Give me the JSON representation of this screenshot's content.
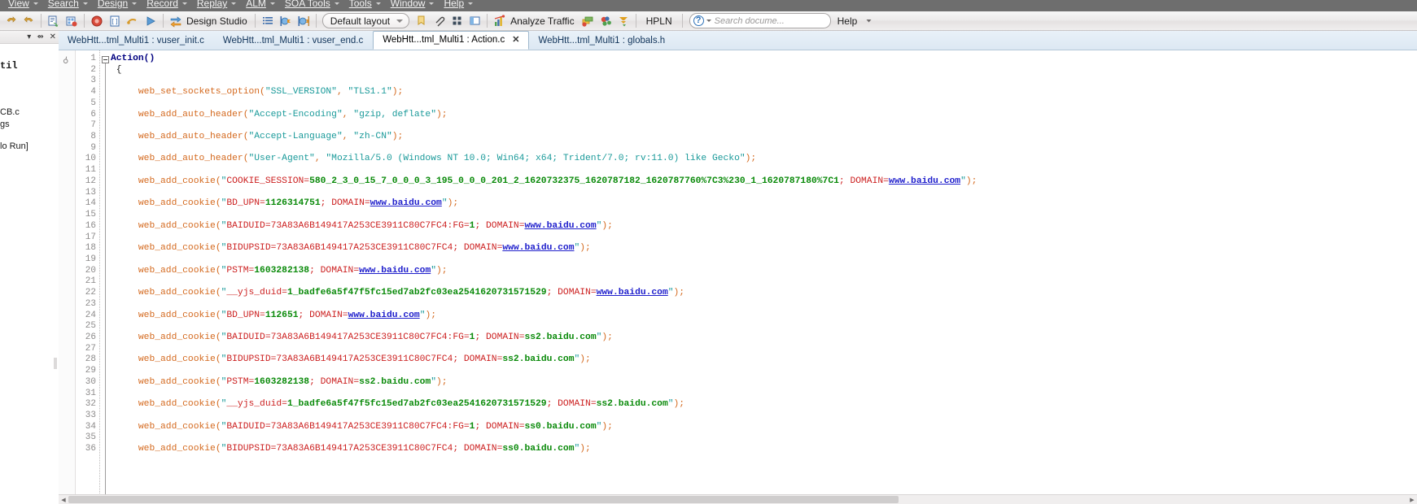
{
  "menubar": {
    "items": [
      {
        "label": "View",
        "has_caret": true
      },
      {
        "label": "Search",
        "has_caret": true
      },
      {
        "label": "Design",
        "has_caret": true
      },
      {
        "label": "Record",
        "has_caret": true
      },
      {
        "label": "Replay",
        "has_caret": true
      },
      {
        "label": "ALM",
        "has_caret": true
      },
      {
        "label": "SOA Tools",
        "has_caret": true
      },
      {
        "label": "Tools",
        "has_caret": true
      },
      {
        "label": "Window",
        "has_caret": true
      },
      {
        "label": "Help",
        "has_caret": true
      }
    ]
  },
  "toolbar": {
    "design_studio_label": "Design Studio",
    "layout_label": "Default layout",
    "analyze_traffic_label": "Analyze Traffic",
    "hpln_label": "HPLN",
    "search_placeholder": "Search docume...",
    "help_label": "Help",
    "icons": [
      "undo-icon",
      "redo-icon",
      "recompile-icon",
      "snapshot-icon",
      "record-icon",
      "step-icon",
      "pause-icon",
      "run-icon",
      "design-studio-icon",
      "task-list-icon",
      "runtime-settings-icon",
      "parameter-list-icon",
      "analyze-traffic-icon",
      "correlation-icon",
      "network-icon",
      "export-icon",
      "bookmark-icon",
      "attachment-icon",
      "grid-icon",
      "window-icon"
    ]
  },
  "left_panel": {
    "header_icons": [
      "chevron-down-icon",
      "pin-icon",
      "close-icon"
    ],
    "rows": [
      {
        "text": "til",
        "bold": true
      },
      {
        "text": "CB.c",
        "bold": false
      },
      {
        "text": "gs",
        "bold": false
      },
      {
        "text": "lo Run]",
        "bold": false
      }
    ]
  },
  "tabs": [
    {
      "label": "WebHtt...tml_Multi1 : vuser_init.c",
      "active": false,
      "closable": false
    },
    {
      "label": "WebHtt...tml_Multi1 : vuser_end.c",
      "active": false,
      "closable": false
    },
    {
      "label": "WebHtt...tml_Multi1 : Action.c",
      "active": true,
      "closable": true,
      "close_glyph": "✕"
    },
    {
      "label": "WebHtt...tml_Multi1 : globals.h",
      "active": false,
      "closable": false
    }
  ],
  "editor": {
    "total_lines": 36,
    "line_numbers": [
      1,
      2,
      3,
      4,
      5,
      6,
      7,
      8,
      9,
      10,
      11,
      12,
      13,
      14,
      15,
      16,
      17,
      18,
      19,
      20,
      21,
      22,
      23,
      24,
      25,
      26,
      27,
      28,
      29,
      30,
      31,
      32,
      33,
      34,
      35,
      36
    ],
    "lines": [
      {
        "n": 1,
        "segments": [
          {
            "t": "Action()",
            "c": "kw"
          }
        ]
      },
      {
        "n": 2,
        "segments": [
          {
            "t": " {",
            "c": "brc"
          }
        ]
      },
      {
        "n": 3,
        "segments": []
      },
      {
        "n": 4,
        "segments": [
          {
            "t": "     web_set_sockets_option",
            "c": "fn"
          },
          {
            "t": "(",
            "c": "pun"
          },
          {
            "t": "\"SSL_VERSION\"",
            "c": "str"
          },
          {
            "t": ", ",
            "c": "pun"
          },
          {
            "t": "\"TLS1.1\"",
            "c": "str"
          },
          {
            "t": ");",
            "c": "pun"
          }
        ]
      },
      {
        "n": 5,
        "segments": []
      },
      {
        "n": 6,
        "segments": [
          {
            "t": "     web_add_auto_header",
            "c": "fn"
          },
          {
            "t": "(",
            "c": "pun"
          },
          {
            "t": "\"Accept-Encoding\"",
            "c": "str"
          },
          {
            "t": ", ",
            "c": "pun"
          },
          {
            "t": "\"gzip, deflate\"",
            "c": "str"
          },
          {
            "t": ");",
            "c": "pun"
          }
        ]
      },
      {
        "n": 7,
        "segments": []
      },
      {
        "n": 8,
        "segments": [
          {
            "t": "     web_add_auto_header",
            "c": "fn"
          },
          {
            "t": "(",
            "c": "pun"
          },
          {
            "t": "\"Accept-Language\"",
            "c": "str"
          },
          {
            "t": ", ",
            "c": "pun"
          },
          {
            "t": "\"zh-CN\"",
            "c": "str"
          },
          {
            "t": ");",
            "c": "pun"
          }
        ]
      },
      {
        "n": 9,
        "segments": []
      },
      {
        "n": 10,
        "segments": [
          {
            "t": "     web_add_auto_header",
            "c": "fn"
          },
          {
            "t": "(",
            "c": "pun"
          },
          {
            "t": "\"User-Agent\"",
            "c": "str"
          },
          {
            "t": ", ",
            "c": "pun"
          },
          {
            "t": "\"Mozilla/5.0 (Windows NT 10.0; Win64; x64; Trident/7.0; rv:11.0) like Gecko\"",
            "c": "str"
          },
          {
            "t": ");",
            "c": "pun"
          }
        ]
      },
      {
        "n": 11,
        "segments": []
      },
      {
        "n": 12,
        "segments": [
          {
            "t": "     web_add_cookie",
            "c": "fn"
          },
          {
            "t": "(",
            "c": "pun"
          },
          {
            "t": "\"",
            "c": "str"
          },
          {
            "t": "COOKIE_SESSION=",
            "c": "ckey"
          },
          {
            "t": "580_2_3_0_15_7_0_0_0_3_195_0_0_0_201_2_1620732375_1620787182_1620787760%7C3%230_1_1620787180%7C1",
            "c": "cval"
          },
          {
            "t": "; ",
            "c": "ckey"
          },
          {
            "t": "DOMAIN=",
            "c": "dom"
          },
          {
            "t": "www.baidu.com",
            "c": "lnk"
          },
          {
            "t": "\"",
            "c": "str"
          },
          {
            "t": ");",
            "c": "pun"
          }
        ]
      },
      {
        "n": 13,
        "segments": []
      },
      {
        "n": 14,
        "segments": [
          {
            "t": "     web_add_cookie",
            "c": "fn"
          },
          {
            "t": "(",
            "c": "pun"
          },
          {
            "t": "\"",
            "c": "str"
          },
          {
            "t": "BD_UPN=",
            "c": "ckey"
          },
          {
            "t": "1126314751",
            "c": "cval"
          },
          {
            "t": "; ",
            "c": "ckey"
          },
          {
            "t": "DOMAIN=",
            "c": "dom"
          },
          {
            "t": "www.baidu.com",
            "c": "lnk"
          },
          {
            "t": "\"",
            "c": "str"
          },
          {
            "t": ");",
            "c": "pun"
          }
        ]
      },
      {
        "n": 15,
        "segments": []
      },
      {
        "n": 16,
        "segments": [
          {
            "t": "     web_add_cookie",
            "c": "fn"
          },
          {
            "t": "(",
            "c": "pun"
          },
          {
            "t": "\"",
            "c": "str"
          },
          {
            "t": "BAIDUID=73A83A6B149417A253CE3911C80C7FC4:FG=",
            "c": "ckey"
          },
          {
            "t": "1",
            "c": "cval"
          },
          {
            "t": "; ",
            "c": "ckey"
          },
          {
            "t": "DOMAIN=",
            "c": "dom"
          },
          {
            "t": "www.baidu.com",
            "c": "lnk"
          },
          {
            "t": "\"",
            "c": "str"
          },
          {
            "t": ");",
            "c": "pun"
          }
        ]
      },
      {
        "n": 17,
        "segments": []
      },
      {
        "n": 18,
        "segments": [
          {
            "t": "     web_add_cookie",
            "c": "fn"
          },
          {
            "t": "(",
            "c": "pun"
          },
          {
            "t": "\"",
            "c": "str"
          },
          {
            "t": "BIDUPSID=73A83A6B149417A253CE3911C80C7FC4",
            "c": "ckey"
          },
          {
            "t": "; ",
            "c": "ckey"
          },
          {
            "t": "DOMAIN=",
            "c": "dom"
          },
          {
            "t": "www.baidu.com",
            "c": "lnk"
          },
          {
            "t": "\"",
            "c": "str"
          },
          {
            "t": ");",
            "c": "pun"
          }
        ]
      },
      {
        "n": 19,
        "segments": []
      },
      {
        "n": 20,
        "segments": [
          {
            "t": "     web_add_cookie",
            "c": "fn"
          },
          {
            "t": "(",
            "c": "pun"
          },
          {
            "t": "\"",
            "c": "str"
          },
          {
            "t": "PSTM=",
            "c": "ckey"
          },
          {
            "t": "1603282138",
            "c": "cval"
          },
          {
            "t": "; ",
            "c": "ckey"
          },
          {
            "t": "DOMAIN=",
            "c": "dom"
          },
          {
            "t": "www.baidu.com",
            "c": "lnk"
          },
          {
            "t": "\"",
            "c": "str"
          },
          {
            "t": ");",
            "c": "pun"
          }
        ]
      },
      {
        "n": 21,
        "segments": []
      },
      {
        "n": 22,
        "segments": [
          {
            "t": "     web_add_cookie",
            "c": "fn"
          },
          {
            "t": "(",
            "c": "pun"
          },
          {
            "t": "\"",
            "c": "str"
          },
          {
            "t": "__yjs_duid=",
            "c": "ckey"
          },
          {
            "t": "1_badfe6a5f47f5fc15ed7ab2fc03ea2541620731571529",
            "c": "cval"
          },
          {
            "t": "; ",
            "c": "ckey"
          },
          {
            "t": "DOMAIN=",
            "c": "dom"
          },
          {
            "t": "www.baidu.com",
            "c": "lnk"
          },
          {
            "t": "\"",
            "c": "str"
          },
          {
            "t": ");",
            "c": "pun"
          }
        ]
      },
      {
        "n": 23,
        "segments": []
      },
      {
        "n": 24,
        "segments": [
          {
            "t": "     web_add_cookie",
            "c": "fn"
          },
          {
            "t": "(",
            "c": "pun"
          },
          {
            "t": "\"",
            "c": "str"
          },
          {
            "t": "BD_UPN=",
            "c": "ckey"
          },
          {
            "t": "112651",
            "c": "cval"
          },
          {
            "t": "; ",
            "c": "ckey"
          },
          {
            "t": "DOMAIN=",
            "c": "dom"
          },
          {
            "t": "www.baidu.com",
            "c": "lnk"
          },
          {
            "t": "\"",
            "c": "str"
          },
          {
            "t": ");",
            "c": "pun"
          }
        ]
      },
      {
        "n": 25,
        "segments": []
      },
      {
        "n": 26,
        "segments": [
          {
            "t": "     web_add_cookie",
            "c": "fn"
          },
          {
            "t": "(",
            "c": "pun"
          },
          {
            "t": "\"",
            "c": "str"
          },
          {
            "t": "BAIDUID=73A83A6B149417A253CE3911C80C7FC4:FG=",
            "c": "ckey"
          },
          {
            "t": "1",
            "c": "cval"
          },
          {
            "t": "; ",
            "c": "ckey"
          },
          {
            "t": "DOMAIN=",
            "c": "dom"
          },
          {
            "t": "ss2.baidu.com",
            "c": "cval"
          },
          {
            "t": "\"",
            "c": "str"
          },
          {
            "t": ");",
            "c": "pun"
          }
        ]
      },
      {
        "n": 27,
        "segments": []
      },
      {
        "n": 28,
        "segments": [
          {
            "t": "     web_add_cookie",
            "c": "fn"
          },
          {
            "t": "(",
            "c": "pun"
          },
          {
            "t": "\"",
            "c": "str"
          },
          {
            "t": "BIDUPSID=73A83A6B149417A253CE3911C80C7FC4",
            "c": "ckey"
          },
          {
            "t": "; ",
            "c": "ckey"
          },
          {
            "t": "DOMAIN=",
            "c": "dom"
          },
          {
            "t": "ss2.baidu.com",
            "c": "cval"
          },
          {
            "t": "\"",
            "c": "str"
          },
          {
            "t": ");",
            "c": "pun"
          }
        ]
      },
      {
        "n": 29,
        "segments": []
      },
      {
        "n": 30,
        "segments": [
          {
            "t": "     web_add_cookie",
            "c": "fn"
          },
          {
            "t": "(",
            "c": "pun"
          },
          {
            "t": "\"",
            "c": "str"
          },
          {
            "t": "PSTM=",
            "c": "ckey"
          },
          {
            "t": "1603282138",
            "c": "cval"
          },
          {
            "t": "; ",
            "c": "ckey"
          },
          {
            "t": "DOMAIN=",
            "c": "dom"
          },
          {
            "t": "ss2.baidu.com",
            "c": "cval"
          },
          {
            "t": "\"",
            "c": "str"
          },
          {
            "t": ");",
            "c": "pun"
          }
        ]
      },
      {
        "n": 31,
        "segments": []
      },
      {
        "n": 32,
        "segments": [
          {
            "t": "     web_add_cookie",
            "c": "fn"
          },
          {
            "t": "(",
            "c": "pun"
          },
          {
            "t": "\"",
            "c": "str"
          },
          {
            "t": "__yjs_duid=",
            "c": "ckey"
          },
          {
            "t": "1_badfe6a5f47f5fc15ed7ab2fc03ea2541620731571529",
            "c": "cval"
          },
          {
            "t": "; ",
            "c": "ckey"
          },
          {
            "t": "DOMAIN=",
            "c": "dom"
          },
          {
            "t": "ss2.baidu.com",
            "c": "cval"
          },
          {
            "t": "\"",
            "c": "str"
          },
          {
            "t": ");",
            "c": "pun"
          }
        ]
      },
      {
        "n": 33,
        "segments": []
      },
      {
        "n": 34,
        "segments": [
          {
            "t": "     web_add_cookie",
            "c": "fn"
          },
          {
            "t": "(",
            "c": "pun"
          },
          {
            "t": "\"",
            "c": "str"
          },
          {
            "t": "BAIDUID=73A83A6B149417A253CE3911C80C7FC4:FG=",
            "c": "ckey"
          },
          {
            "t": "1",
            "c": "cval"
          },
          {
            "t": "; ",
            "c": "ckey"
          },
          {
            "t": "DOMAIN=",
            "c": "dom"
          },
          {
            "t": "ss0.baidu.com",
            "c": "cval"
          },
          {
            "t": "\"",
            "c": "str"
          },
          {
            "t": ");",
            "c": "pun"
          }
        ]
      },
      {
        "n": 35,
        "segments": []
      },
      {
        "n": 36,
        "segments": [
          {
            "t": "     web_add_cookie",
            "c": "fn"
          },
          {
            "t": "(",
            "c": "pun"
          },
          {
            "t": "\"",
            "c": "str"
          },
          {
            "t": "BIDUPSID=73A83A6B149417A253CE3911C80C7FC4",
            "c": "ckey"
          },
          {
            "t": "; ",
            "c": "ckey"
          },
          {
            "t": "DOMAIN=",
            "c": "dom"
          },
          {
            "t": "ss0.baidu.com",
            "c": "cval"
          },
          {
            "t": "\"",
            "c": "str"
          },
          {
            "t": ");",
            "c": "pun"
          }
        ]
      }
    ]
  },
  "colors": {
    "menubar_bg": "#6e6e6e",
    "toolbar_bg": "#ebe9e9",
    "tab_active_bg": "#ffffff",
    "tabbar_bg": "#dce8f3",
    "function_orange": "#d4691e",
    "string_teal": "#1a9a9a",
    "cookie_key_red": "#cc2020",
    "cookie_value_green": "#0a8a0a",
    "link_blue": "#2020cc",
    "keyword_navy": "#000080"
  }
}
